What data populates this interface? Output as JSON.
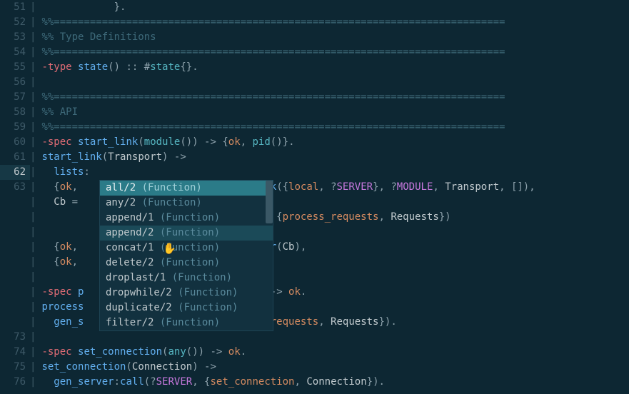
{
  "lines": [
    {
      "num": "51",
      "active": false,
      "tokens": [
        {
          "cls": "c-punct",
          "indent": 12,
          "t": "}."
        }
      ]
    },
    {
      "num": "52",
      "active": false,
      "tokens": [
        {
          "cls": "c-comment",
          "t": "%%==========================================================================="
        }
      ]
    },
    {
      "num": "53",
      "active": false,
      "tokens": [
        {
          "cls": "c-comment",
          "t": "%% Type Definitions"
        }
      ]
    },
    {
      "num": "54",
      "active": false,
      "tokens": [
        {
          "cls": "c-comment",
          "t": "%%==========================================================================="
        }
      ]
    },
    {
      "num": "55",
      "active": false,
      "tokens": [
        {
          "cls": "c-keyword",
          "t": "-type"
        },
        {
          "cls": "c-punct",
          "t": " "
        },
        {
          "cls": "c-func",
          "t": "state"
        },
        {
          "cls": "c-punct",
          "t": "() :: #"
        },
        {
          "cls": "c-type",
          "t": "state"
        },
        {
          "cls": "c-punct",
          "t": "{}."
        }
      ]
    },
    {
      "num": "56",
      "active": false,
      "tokens": []
    },
    {
      "num": "57",
      "active": false,
      "tokens": [
        {
          "cls": "c-comment",
          "t": "%%==========================================================================="
        }
      ]
    },
    {
      "num": "58",
      "active": false,
      "tokens": [
        {
          "cls": "c-comment",
          "t": "%% API"
        }
      ]
    },
    {
      "num": "59",
      "active": false,
      "tokens": [
        {
          "cls": "c-comment",
          "t": "%%==========================================================================="
        }
      ]
    },
    {
      "num": "60",
      "active": false,
      "tokens": [
        {
          "cls": "c-keyword",
          "t": "-spec"
        },
        {
          "cls": "c-punct",
          "t": " "
        },
        {
          "cls": "c-func",
          "t": "start_link"
        },
        {
          "cls": "c-punct",
          "t": "("
        },
        {
          "cls": "c-type",
          "t": "module"
        },
        {
          "cls": "c-punct",
          "t": "()) -> {"
        },
        {
          "cls": "c-ok",
          "t": "ok"
        },
        {
          "cls": "c-punct",
          "t": ", "
        },
        {
          "cls": "c-type",
          "t": "pid"
        },
        {
          "cls": "c-punct",
          "t": "()}."
        }
      ]
    },
    {
      "num": "61",
      "active": false,
      "tokens": [
        {
          "cls": "c-func",
          "t": "start_link"
        },
        {
          "cls": "c-punct",
          "t": "("
        },
        {
          "cls": "c-param",
          "t": "Transport"
        },
        {
          "cls": "c-punct",
          "t": ") ->"
        }
      ]
    },
    {
      "num": "62",
      "active": true,
      "tokens": [
        {
          "cls": "c-func",
          "indent": 2,
          "t": "lists"
        },
        {
          "cls": "c-punct",
          "t": ":"
        }
      ]
    },
    {
      "num": "63",
      "active": false,
      "tokens": [
        {
          "cls": "c-punct",
          "indent": 2,
          "t": "{"
        },
        {
          "cls": "c-ok",
          "t": "ok"
        },
        {
          "cls": "c-punct",
          "t": ", "
        },
        {
          "cls": "c-var",
          "t": "                             "
        },
        {
          "cls": "c-func",
          "t": "ink"
        },
        {
          "cls": "c-punct",
          "t": "({"
        },
        {
          "cls": "c-atom",
          "t": "local"
        },
        {
          "cls": "c-punct",
          "t": ", ?"
        },
        {
          "cls": "c-macro",
          "t": "SERVER"
        },
        {
          "cls": "c-punct",
          "t": "}, ?"
        },
        {
          "cls": "c-macro",
          "t": "MODULE"
        },
        {
          "cls": "c-punct",
          "t": ", "
        },
        {
          "cls": "c-param",
          "t": "Transport"
        },
        {
          "cls": "c-punct",
          "t": ", []),"
        }
      ]
    },
    {
      "num": "",
      "active": false,
      "tokens": [
        {
          "cls": "c-param",
          "indent": 2,
          "t": "Cb"
        },
        {
          "cls": "c-punct",
          "t": " = "
        }
      ]
    },
    {
      "num": "",
      "active": false,
      "tokens": [
        {
          "cls": "c-punct",
          "indent": 39,
          "t": "{"
        },
        {
          "cls": "c-atom",
          "t": "process_requests"
        },
        {
          "cls": "c-punct",
          "t": ", "
        },
        {
          "cls": "c-param",
          "t": "Requests"
        },
        {
          "cls": "c-punct",
          "t": "})"
        }
      ]
    },
    {
      "num": "",
      "active": false,
      "tokens": []
    },
    {
      "num": "",
      "active": false,
      "tokens": [
        {
          "cls": "c-punct",
          "indent": 2,
          "t": "{"
        },
        {
          "cls": "c-ok",
          "t": "ok"
        },
        {
          "cls": "c-punct",
          "t": ", "
        },
        {
          "cls": "c-func",
          "t": "                            ener"
        },
        {
          "cls": "c-punct",
          "t": "("
        },
        {
          "cls": "c-param",
          "t": "Cb"
        },
        {
          "cls": "c-punct",
          "t": "),"
        }
      ]
    },
    {
      "num": "",
      "active": false,
      "tokens": [
        {
          "cls": "c-punct",
          "indent": 2,
          "t": "{"
        },
        {
          "cls": "c-ok",
          "t": "ok"
        },
        {
          "cls": "c-punct",
          "t": ", "
        }
      ]
    },
    {
      "num": "",
      "active": false,
      "tokens": []
    },
    {
      "num": "",
      "active": false,
      "tokens": [
        {
          "cls": "c-keyword",
          "t": "-spec"
        },
        {
          "cls": "c-punct",
          "t": " "
        },
        {
          "cls": "c-func",
          "t": "p"
        },
        {
          "cls": "c-punct",
          "t": "                             ) -> "
        },
        {
          "cls": "c-ok",
          "t": "ok"
        },
        {
          "cls": "c-punct",
          "t": "."
        }
      ]
    },
    {
      "num": "",
      "active": false,
      "tokens": [
        {
          "cls": "c-func",
          "t": "process"
        }
      ]
    },
    {
      "num": "",
      "active": false,
      "tokens": [
        {
          "cls": "c-func",
          "indent": 2,
          "t": "gen_s"
        },
        {
          "cls": "c-punct",
          "t": "                           "
        },
        {
          "cls": "c-atom",
          "t": "ess_requests"
        },
        {
          "cls": "c-punct",
          "t": ", "
        },
        {
          "cls": "c-param",
          "t": "Requests"
        },
        {
          "cls": "c-punct",
          "t": "})."
        }
      ]
    },
    {
      "num": "73",
      "active": false,
      "tokens": []
    },
    {
      "num": "74",
      "active": false,
      "tokens": [
        {
          "cls": "c-keyword",
          "t": "-spec"
        },
        {
          "cls": "c-punct",
          "t": " "
        },
        {
          "cls": "c-func",
          "t": "set_connection"
        },
        {
          "cls": "c-punct",
          "t": "("
        },
        {
          "cls": "c-type",
          "t": "any"
        },
        {
          "cls": "c-punct",
          "t": "()) -> "
        },
        {
          "cls": "c-ok",
          "t": "ok"
        },
        {
          "cls": "c-punct",
          "t": "."
        }
      ]
    },
    {
      "num": "75",
      "active": false,
      "tokens": [
        {
          "cls": "c-func",
          "t": "set_connection"
        },
        {
          "cls": "c-punct",
          "t": "("
        },
        {
          "cls": "c-param",
          "t": "Connection"
        },
        {
          "cls": "c-punct",
          "t": ") ->"
        }
      ]
    },
    {
      "num": "76",
      "active": false,
      "tokens": [
        {
          "cls": "c-func",
          "indent": 2,
          "t": "gen_server"
        },
        {
          "cls": "c-punct",
          "t": ":"
        },
        {
          "cls": "c-func",
          "t": "call"
        },
        {
          "cls": "c-punct",
          "t": "(?"
        },
        {
          "cls": "c-macro",
          "t": "SERVER"
        },
        {
          "cls": "c-punct",
          "t": ", {"
        },
        {
          "cls": "c-atom",
          "t": "set_connection"
        },
        {
          "cls": "c-punct",
          "t": ", "
        },
        {
          "cls": "c-param",
          "t": "Connection"
        },
        {
          "cls": "c-punct",
          "t": "})."
        }
      ]
    }
  ],
  "autocomplete": {
    "items": [
      {
        "name": "all/2",
        "kind": "(Function)",
        "state": "selected"
      },
      {
        "name": "any/2",
        "kind": "(Function)",
        "state": ""
      },
      {
        "name": "append/1",
        "kind": "(Function)",
        "state": ""
      },
      {
        "name": "append/2",
        "kind": "(Function)",
        "state": "hover"
      },
      {
        "name": "concat/1",
        "kind": "(Function)",
        "state": ""
      },
      {
        "name": "delete/2",
        "kind": "(Function)",
        "state": ""
      },
      {
        "name": "droplast/1",
        "kind": "(Function)",
        "state": ""
      },
      {
        "name": "dropwhile/2",
        "kind": "(Function)",
        "state": ""
      },
      {
        "name": "duplicate/2",
        "kind": "(Function)",
        "state": ""
      },
      {
        "name": "filter/2",
        "kind": "(Function)",
        "state": ""
      }
    ]
  },
  "cursor_glyph": "✋"
}
